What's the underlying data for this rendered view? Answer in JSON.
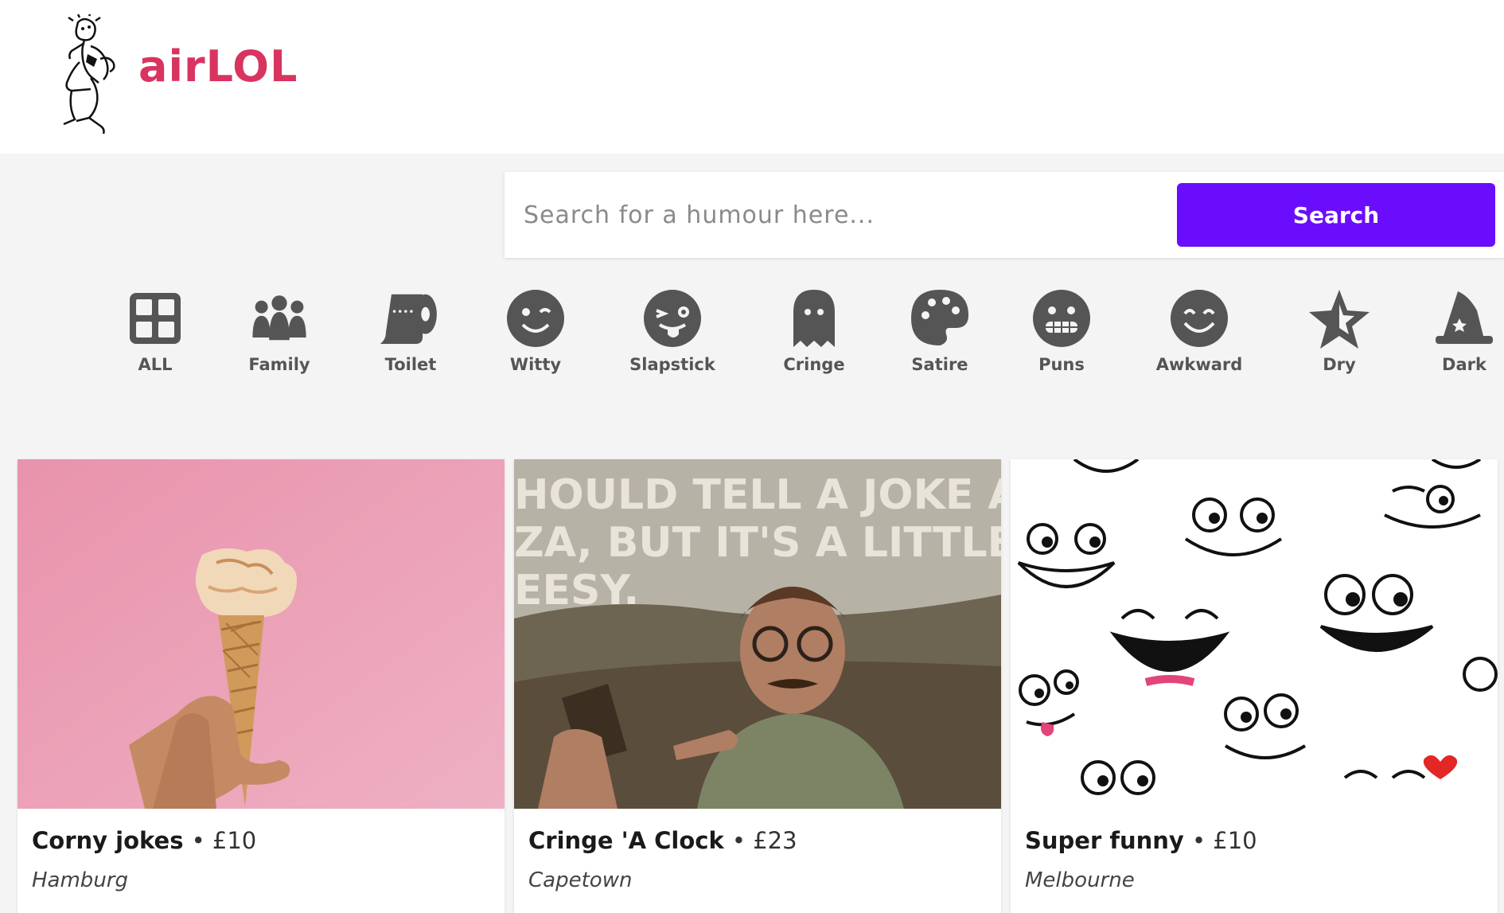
{
  "brand": {
    "name": "airLOL",
    "color": "#d8345f"
  },
  "search": {
    "placeholder": "Search for a humour here...",
    "button_label": "Search",
    "button_color": "#6a0dfc"
  },
  "categories": [
    {
      "label": "ALL",
      "icon": "grid-icon"
    },
    {
      "label": "Family",
      "icon": "family-icon"
    },
    {
      "label": "Toilet",
      "icon": "toilet-roll-icon"
    },
    {
      "label": "Witty",
      "icon": "wink-face-icon"
    },
    {
      "label": "Slapstick",
      "icon": "tongue-face-icon"
    },
    {
      "label": "Cringe",
      "icon": "ghost-icon"
    },
    {
      "label": "Satire",
      "icon": "palette-icon"
    },
    {
      "label": "Puns",
      "icon": "grimace-face-icon"
    },
    {
      "label": "Awkward",
      "icon": "smile-face-icon"
    },
    {
      "label": "Dry",
      "icon": "star-icon"
    },
    {
      "label": "Dark",
      "icon": "wizard-hat-icon"
    }
  ],
  "cards": [
    {
      "title": "Corny jokes",
      "price": "£10",
      "location": "Hamburg",
      "image": "ice-cream-cone"
    },
    {
      "title": "Cringe 'A Clock",
      "price": "£23",
      "location": "Capetown",
      "image": "pizza-joke-meme",
      "meme_text": [
        "HOULD TELL A JOKE ABO",
        "ZA, BUT IT'S A LITTLE",
        "EESY."
      ]
    },
    {
      "title": "Super funny",
      "price": "£10",
      "location": "Melbourne",
      "image": "cartoon-faces-pattern"
    }
  ]
}
